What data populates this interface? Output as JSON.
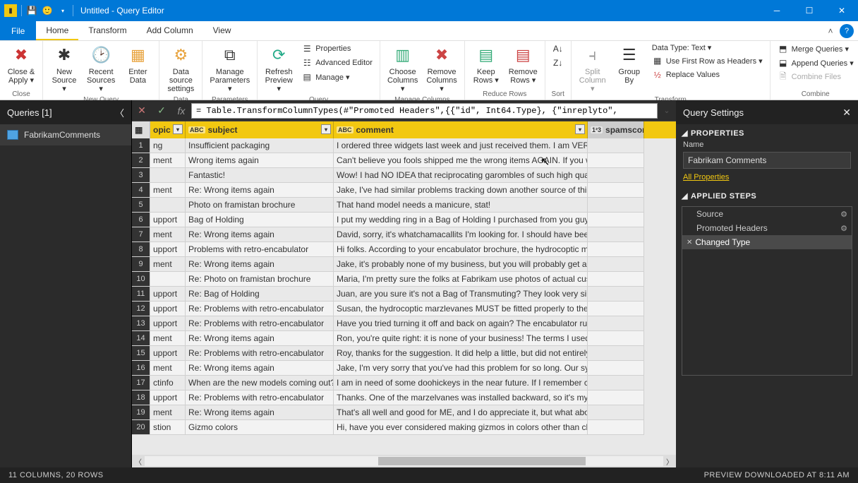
{
  "window": {
    "title": "Untitled - Query Editor"
  },
  "menu": {
    "file": "File",
    "home": "Home",
    "transform": "Transform",
    "addcol": "Add Column",
    "view": "View"
  },
  "ribbon": {
    "close": {
      "btn": "Close &\nApply ▾",
      "group": "Close"
    },
    "newquery": {
      "new": "New\nSource ▾",
      "recent": "Recent\nSources ▾",
      "enter": "Enter\nData",
      "group": "New Query"
    },
    "datasource": {
      "btn": "Data source\nsettings",
      "group": "Data Sources"
    },
    "params": {
      "btn": "Manage\nParameters ▾",
      "group": "Parameters"
    },
    "query": {
      "refresh": "Refresh\nPreview ▾",
      "props": "Properties",
      "adv": "Advanced Editor",
      "manage": "Manage ▾",
      "group": "Query"
    },
    "managecols": {
      "choose": "Choose\nColumns ▾",
      "remove": "Remove\nColumns ▾",
      "group": "Manage Columns"
    },
    "reducerows": {
      "keep": "Keep\nRows ▾",
      "remove": "Remove\nRows ▾",
      "group": "Reduce Rows"
    },
    "sort": {
      "group": "Sort"
    },
    "transform": {
      "split": "Split\nColumn ▾",
      "group": "Group\nBy",
      "dtype": "Data Type: Text ▾",
      "firstrow": "Use First Row as Headers ▾",
      "replace": "Replace Values",
      "tgroup": "Transform"
    },
    "combine": {
      "merge": "Merge Queries ▾",
      "append": "Append Queries ▾",
      "files": "Combine Files",
      "group": "Combine"
    }
  },
  "queries": {
    "header": "Queries [1]",
    "items": [
      "FabrikamComments"
    ]
  },
  "formula": "= Table.TransformColumnTypes(#\"Promoted Headers\",{{\"id\", Int64.Type}, {\"inreplyto\",",
  "columns": {
    "c0": "",
    "c1": "opic",
    "c2": "subject",
    "c3": "comment",
    "c4": "spamscore"
  },
  "rows": [
    {
      "n": 1,
      "c1": "ng",
      "c2": "Insufficient packaging",
      "c3": "I ordered three widgets last week and just received them. I am VERY di…"
    },
    {
      "n": 2,
      "c1": "ment",
      "c2": "Wrong items again",
      "c3": "Can't believe you fools shipped me the wrong items AGAIN. If you wer…"
    },
    {
      "n": 3,
      "c1": "",
      "c2": "Fantastic!",
      "c3": "Wow! I had NO IDEA that reciprocating garombles of such high quality …"
    },
    {
      "n": 4,
      "c1": "ment",
      "c2": "Re: Wrong items again",
      "c3": "Jake, I've had similar problems tracking down another source of thinga…"
    },
    {
      "n": 5,
      "c1": "",
      "c2": "Photo on framistan brochure",
      "c3": "That hand model needs a manicure, stat!"
    },
    {
      "n": 6,
      "c1": "upport",
      "c2": "Bag of Holding",
      "c3": "I put my wedding ring in a Bag of Holding I purchased from you guys (f…"
    },
    {
      "n": 7,
      "c1": "ment",
      "c2": "Re: Wrong items again",
      "c3": "David, sorry, it's whatchamacallits I'm looking for. I should have been …"
    },
    {
      "n": 8,
      "c1": "upport",
      "c2": "Problems with retro-encabulator",
      "c3": "Hi folks. According to your encabulator brochure, the hydrocoptic mar…"
    },
    {
      "n": 9,
      "c1": "ment",
      "c2": "Re: Wrong items again",
      "c3": "Jake, it's probably none of my business, but you will probably get a bet…"
    },
    {
      "n": 10,
      "c1": "",
      "c2": "Re: Photo on framistan brochure",
      "c3": "Maria, I'm pretty sure the folks at Fabrikam use photos of actual custo…"
    },
    {
      "n": 11,
      "c1": "upport",
      "c2": "Re: Bag of Holding",
      "c3": "Juan, are you sure it's not a Bag of Transmuting? They look very simila…"
    },
    {
      "n": 12,
      "c1": "upport",
      "c2": "Re: Problems with retro-encabulator",
      "c3": "Susan, the hydrocoptic marzlevanes MUST be fitted properly to the a…"
    },
    {
      "n": 13,
      "c1": "upport",
      "c2": "Re: Problems with retro-encabulator",
      "c3": "Have you tried turning it off and back on again? The encabulator runs …"
    },
    {
      "n": 14,
      "c1": "ment",
      "c2": "Re: Wrong items again",
      "c3": "Ron, you're quite right: it is none of your business! The terms I used ar…"
    },
    {
      "n": 15,
      "c1": "upport",
      "c2": "Re: Problems with retro-encabulator",
      "c3": "Roy, thanks for the suggestion. It did help a little, but did not entirely e…"
    },
    {
      "n": 16,
      "c1": "ment",
      "c2": "Re: Wrong items again",
      "c3": "Jake, I'm very sorry that you've had this problem for so long. Our syste…"
    },
    {
      "n": 17,
      "c1": "ctinfo",
      "c2": "When are the new models coming out?",
      "c3": "I am in need of some doohickeys in the near future. If I remember corr…"
    },
    {
      "n": 18,
      "c1": "upport",
      "c2": "Re: Problems with retro-encabulator",
      "c3": "Thanks. One of the marzelvanes was installed backward, so it's my faul…"
    },
    {
      "n": 19,
      "c1": "ment",
      "c2": "Re: Wrong items again",
      "c3": "That's all well and good for ME, and I do appreciate it, but what about …"
    },
    {
      "n": 20,
      "c1": "stion",
      "c2": "Gizmo colors",
      "c3": "Hi, have you ever considered making gizmos in colors other than chart…"
    }
  ],
  "settings": {
    "header": "Query Settings",
    "props": "PROPERTIES",
    "name_label": "Name",
    "name_value": "Fabrikam Comments",
    "allprops": "All Properties",
    "applied": "APPLIED STEPS",
    "steps": [
      {
        "label": "Source",
        "gear": true,
        "active": false,
        "x": false
      },
      {
        "label": "Promoted Headers",
        "gear": true,
        "active": false,
        "x": false
      },
      {
        "label": "Changed Type",
        "gear": false,
        "active": true,
        "x": true
      }
    ]
  },
  "status": {
    "left": "11 COLUMNS, 20 ROWS",
    "right": "PREVIEW DOWNLOADED AT 8:11 AM"
  }
}
